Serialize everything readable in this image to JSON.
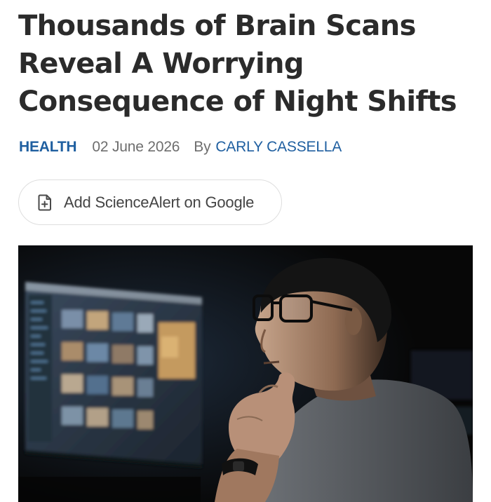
{
  "article": {
    "title": "Thousands of Brain Scans Reveal A Worrying Consequence of Night Shifts",
    "category": "HEALTH",
    "date": "02 June 2026",
    "byline_prefix": "By",
    "author": "CARLY CASSELLA"
  },
  "google_button": {
    "label": "Add ScienceAlert on Google",
    "icon": "add-document-icon"
  },
  "hero_image": {
    "icon": "photo-man-at-monitor-at-night"
  },
  "colors": {
    "link_blue": "#1f5fa0",
    "text_dark": "#2b2b2b",
    "text_muted": "#6e6e6e",
    "button_border": "#dedede"
  }
}
